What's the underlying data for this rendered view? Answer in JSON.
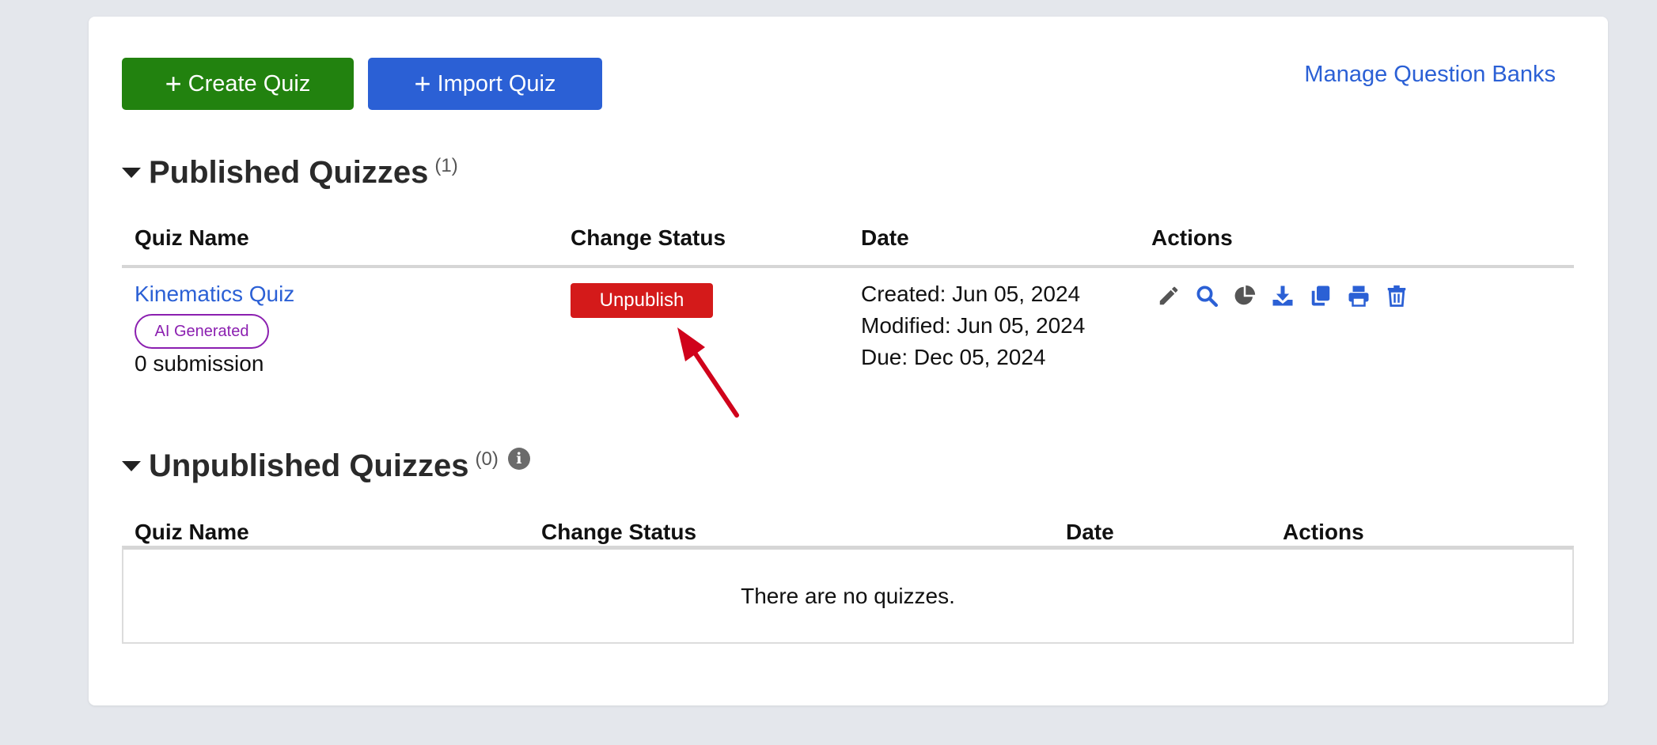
{
  "toolbar": {
    "create_label": "Create Quiz",
    "import_label": "Import Quiz",
    "manage_label": "Manage Question Banks"
  },
  "published": {
    "title": "Published Quizzes",
    "count": "(1)",
    "headers": {
      "name": "Quiz Name",
      "status": "Change Status",
      "date": "Date",
      "actions": "Actions"
    },
    "rows": [
      {
        "name": "Kinematics Quiz",
        "badge": "AI Generated",
        "submissions": "0 submission",
        "status_button": "Unpublish",
        "created": "Created: Jun 05, 2024",
        "modified": "Modified: Jun 05, 2024",
        "due": "Due: Dec 05, 2024",
        "actions": [
          "edit-icon",
          "search-icon",
          "pie-chart-icon",
          "download-icon",
          "copy-icon",
          "print-icon",
          "trash-icon"
        ]
      }
    ]
  },
  "unpublished": {
    "title": "Unpublished Quizzes",
    "count": "(0)",
    "info_glyph": "i",
    "headers": {
      "name": "Quiz Name",
      "status": "Change Status",
      "date": "Date",
      "actions": "Actions"
    },
    "empty_message": "There are no quizzes."
  },
  "colors": {
    "create": "#22820f",
    "import": "#2b60d5",
    "link": "#2b60d5",
    "unpublish": "#d41a1a",
    "badge": "#8b1fb0",
    "annotation_arrow": "#d0021b"
  }
}
